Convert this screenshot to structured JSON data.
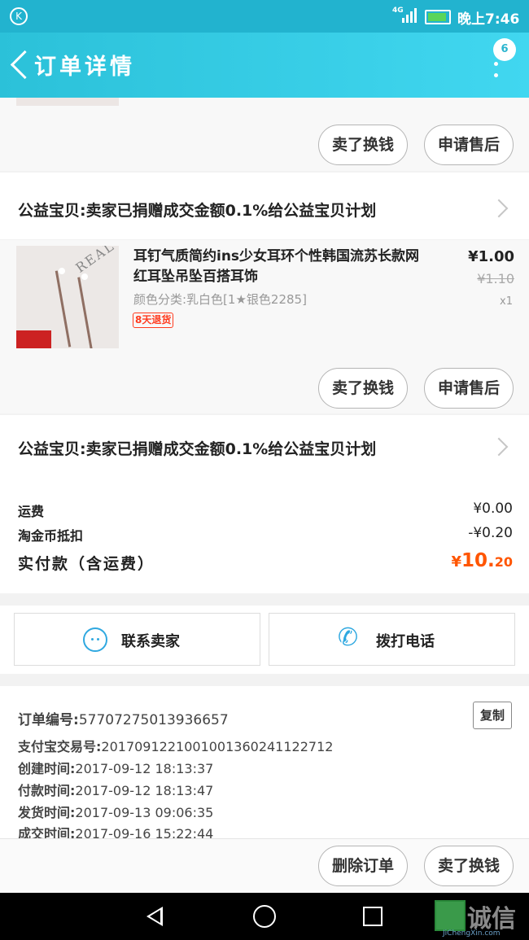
{
  "status_bar": {
    "network": "4G",
    "time": "晚上7:46"
  },
  "header": {
    "title": "订单详情",
    "badge": "6"
  },
  "buttons": {
    "buy_again": "卖了换钱",
    "after_sale": "申请售后",
    "delete_order": "删除订单"
  },
  "charity": {
    "text": "公益宝贝:卖家已捐赠成交金额0.1%给公益宝贝计划"
  },
  "product": {
    "title": "耳钉气质简约ins少女耳环个性韩国流苏长款网红耳坠吊坠百搭耳饰",
    "sku": "颜色分类:乳白色[1★银色2285]",
    "tag": "8天退货",
    "price": "¥1.00",
    "original_price": "¥1.10",
    "quantity": "x1",
    "image_text": "REAL"
  },
  "summary": {
    "shipping_label": "运费",
    "shipping_value": "¥0.00",
    "coin_label": "淘金币抵扣",
    "coin_value": "-¥0.20",
    "paid_label": "实付款（含运费）",
    "paid_symbol": "¥",
    "paid_int": "10.",
    "paid_dec": "20",
    "paid_color": "#ff5500"
  },
  "contact": {
    "seller": "联系卖家",
    "phone": "拨打电话"
  },
  "order_info": {
    "order_no_label": "订单编号:",
    "order_no": "57707275013936657",
    "copy": "复制",
    "alipay_label": "支付宝交易号:",
    "alipay": "2017091221001001360241122712",
    "created_label": "创建时间:",
    "created": "2017-09-12 18:13:37",
    "paid_label": "付款时间:",
    "paid": "2017-09-12 18:13:47",
    "shipped_label": "发货时间:",
    "shipped": "2017-09-13 09:06:35",
    "done_label": "成交时间:",
    "done": "2017-09-16 15:22:44"
  },
  "watermark": {
    "text": "诚信",
    "sub": "JiChengXin.com"
  },
  "colors": {
    "accent": "#2bc1d9",
    "price": "#ff5500"
  }
}
